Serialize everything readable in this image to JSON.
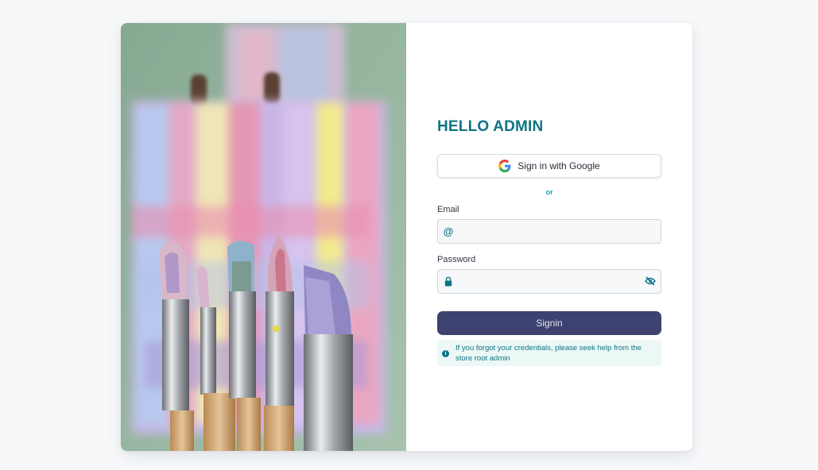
{
  "login": {
    "title": "HELLO ADMIN",
    "google_button_label": "Sign in with Google",
    "divider_text": "or",
    "email": {
      "label": "Email",
      "value": "",
      "icon": "at-icon",
      "icon_glyph": "@"
    },
    "password": {
      "label": "Password",
      "value": "",
      "icon": "lock-icon",
      "toggle_icon": "eye-off-icon"
    },
    "signin_button_label": "Signin",
    "help_text": "If you forgot your credentials, please seek help from the store root admin"
  },
  "hero_image": {
    "subject": "paintbrushes-in-front-of-painted-canvas-photo"
  },
  "colors": {
    "accent": "#0f7485",
    "primary_button": "#3d4270",
    "notice_background": "#ebf8f6",
    "page_background": "#f6f8fa"
  }
}
